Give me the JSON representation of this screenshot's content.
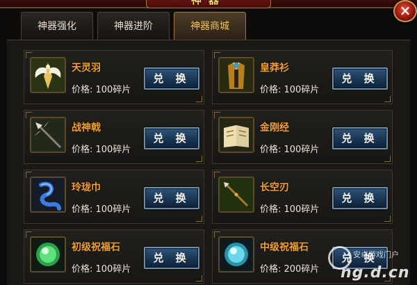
{
  "window": {
    "title": "神器",
    "close_label": "×"
  },
  "tabs": [
    {
      "label": "神器强化",
      "active": false
    },
    {
      "label": "神器进阶",
      "active": false
    },
    {
      "label": "神器商城",
      "active": true
    }
  ],
  "items": [
    {
      "name": "天灵羽",
      "price": "价格: 100碎片",
      "button": "兑 换",
      "icon": "angel-wings-icon"
    },
    {
      "name": "皇莽衫",
      "price": "价格: 100碎片",
      "button": "兑 换",
      "icon": "royal-robe-icon"
    },
    {
      "name": "战神戟",
      "price": "价格: 100碎片",
      "button": "兑 换",
      "icon": "halberd-icon"
    },
    {
      "name": "金刚经",
      "price": "价格: 100碎片",
      "button": "兑 换",
      "icon": "scripture-book-icon"
    },
    {
      "name": "玲珑巾",
      "price": "价格: 100碎片",
      "button": "兑 换",
      "icon": "silk-scarf-icon"
    },
    {
      "name": "长空刃",
      "price": "价格: 100碎片",
      "button": "兑 换",
      "icon": "spear-blade-icon"
    },
    {
      "name": "初级祝福石",
      "price": "价格: 100碎片",
      "button": "兑 换",
      "icon": "green-blessing-stone-icon"
    },
    {
      "name": "中级祝福石",
      "price": "价格: 200碎片",
      "button": "兑 换",
      "icon": "blue-blessing-stone-icon"
    }
  ],
  "watermark": {
    "small_text": "安卓游戏门户",
    "big_text": "ng.d.cn"
  },
  "colors": {
    "item_name": "#f2a030",
    "active_tab_text": "#f0c060",
    "button_bg": "#173350"
  }
}
